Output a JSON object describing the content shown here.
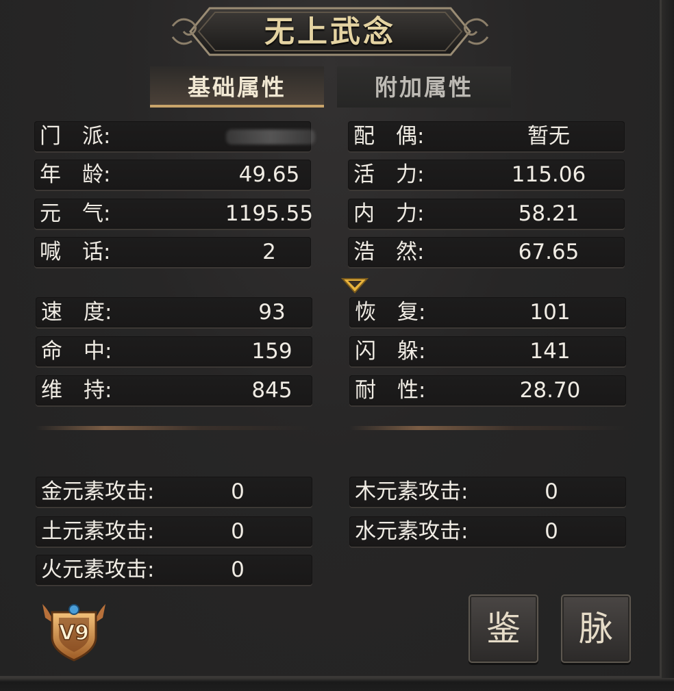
{
  "title": "无上武念",
  "tabs": [
    {
      "label": "基础属性",
      "active": true
    },
    {
      "label": "附加属性",
      "active": false
    }
  ],
  "basic_left": [
    {
      "label": "门　派:",
      "value": ""
    },
    {
      "label": "年　龄:",
      "value": "49.65"
    },
    {
      "label": "元　气:",
      "value": "1195.55"
    },
    {
      "label": "喊　话:",
      "value": "2"
    }
  ],
  "basic_right": [
    {
      "label": "配　偶:",
      "value": "暂无"
    },
    {
      "label": "活　力:",
      "value": "115.06"
    },
    {
      "label": "内　力:",
      "value": "58.21"
    },
    {
      "label": "浩　然:",
      "value": "67.65"
    }
  ],
  "combat_left": [
    {
      "label": "速　度:",
      "value": "93"
    },
    {
      "label": "命　中:",
      "value": "159"
    },
    {
      "label": "维　持:",
      "value": "845"
    }
  ],
  "combat_right": [
    {
      "label": "恢　复:",
      "value": "101"
    },
    {
      "label": "闪　躲:",
      "value": "141"
    },
    {
      "label": "耐　性:",
      "value": "28.70"
    }
  ],
  "element_left": [
    {
      "label": "金元素攻击:",
      "value": "0"
    },
    {
      "label": "土元素攻击:",
      "value": "0"
    },
    {
      "label": "火元素攻击:",
      "value": "0"
    }
  ],
  "element_right": [
    {
      "label": "木元素攻击:",
      "value": "0"
    },
    {
      "label": "水元素攻击:",
      "value": "0"
    }
  ],
  "vip_badge": {
    "text": "V9",
    "icon": "vip-shield-icon"
  },
  "buttons": {
    "identify": "鉴",
    "meridian": "脉"
  },
  "colors": {
    "gold_text": "#e4d3a2",
    "tab_underline": "#c9a46a",
    "chevron": "#e8b33c"
  }
}
